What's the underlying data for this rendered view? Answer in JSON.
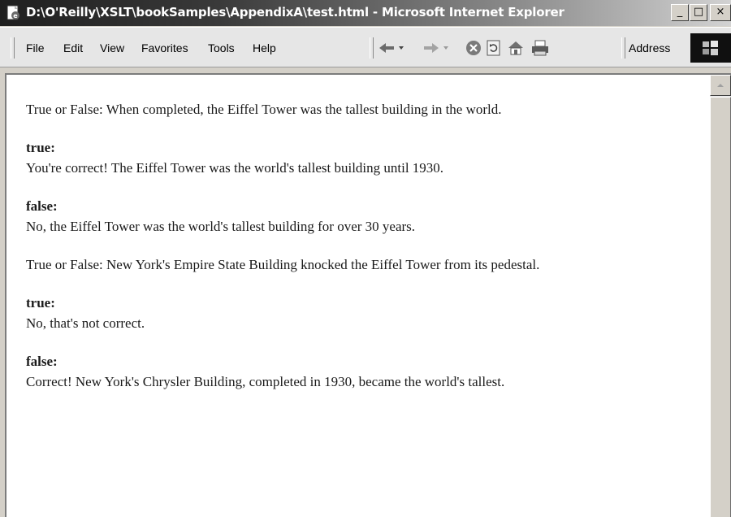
{
  "window": {
    "title": "D:\\O'Reilly\\XSLT\\bookSamples\\AppendixA\\test.html - Microsoft Internet Explorer",
    "app_icon": "ie-page-icon",
    "controls": {
      "minimize": "_",
      "maximize": "□",
      "close": "×"
    }
  },
  "menubar": {
    "items": [
      "File",
      "Edit",
      "View",
      "Favorites",
      "Tools",
      "Help"
    ],
    "toolbar_icons": [
      "back-icon",
      "forward-icon",
      "stop-icon",
      "refresh-icon",
      "home-icon",
      "print-icon"
    ],
    "address_label": "Address",
    "logo_icon": "windows-flag-icon"
  },
  "content": {
    "quizzes": [
      {
        "question": "True or False: When completed, the Eiffel Tower was the tallest building in the world.",
        "answers": [
          {
            "label": "true:",
            "text": "You're correct! The Eiffel Tower was the world's tallest building until 1930."
          },
          {
            "label": "false:",
            "text": "No, the Eiffel Tower was the world's tallest building for over 30 years."
          }
        ]
      },
      {
        "question": "True or False: New York's Empire State Building knocked the Eiffel Tower from its pedestal.",
        "answers": [
          {
            "label": "true:",
            "text": "No, that's not correct."
          },
          {
            "label": "false:",
            "text": "Correct! New York's Chrysler Building, completed in 1930, became the world's tallest."
          }
        ]
      }
    ]
  },
  "scrollbar": {
    "up_arrow_icon": "scroll-up-arrow-icon"
  }
}
